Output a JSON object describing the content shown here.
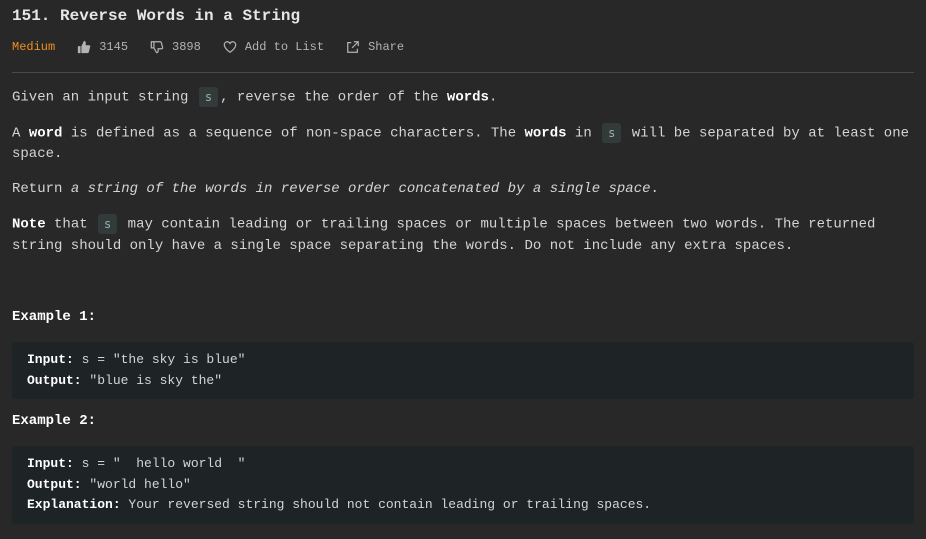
{
  "problem": {
    "title": "151. Reverse Words in a String",
    "difficulty": "Medium",
    "likes": "3145",
    "dislikes": "3898",
    "add_to_list": "Add to List",
    "share": "Share"
  },
  "description": {
    "p1": {
      "text_a": "Given an input string ",
      "code": "s",
      "text_b": ", reverse the order of the ",
      "bold": "words",
      "text_c": "."
    },
    "p2": {
      "text_a": "A ",
      "bold_a": "word",
      "text_b": " is defined as a sequence of non-space characters. The ",
      "bold_b": "words",
      "text_c": " in ",
      "code": "s",
      "text_d": " will be separated by at least one space."
    },
    "p3": {
      "text_a": "Return ",
      "italic": "a string of the words in reverse order concatenated by a single space",
      "text_b": "."
    },
    "p4": {
      "bold": "Note",
      "text_a": " that ",
      "code": "s",
      "text_b": " may contain leading or trailing spaces or multiple spaces between two words. The returned string should only have a single space separating the words. Do not include any extra spaces."
    }
  },
  "examples": [
    {
      "title": "Example 1:",
      "input_label": "Input:",
      "input_value": " s = \"the sky is blue\"",
      "output_label": "Output:",
      "output_value": " \"blue is sky the\""
    },
    {
      "title": "Example 2:",
      "input_label": "Input:",
      "input_value": " s = \"  hello world  \"",
      "output_label": "Output:",
      "output_value": " \"world hello\"",
      "explanation_label": "Explanation:",
      "explanation_value": " Your reversed string should not contain leading or trailing spaces."
    }
  ]
}
